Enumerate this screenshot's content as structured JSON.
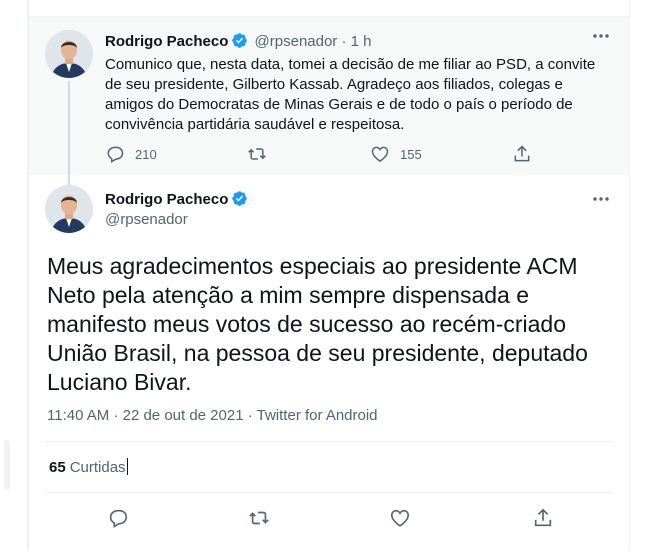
{
  "parent_tweet": {
    "author_name": "Rodrigo Pacheco",
    "handle": "@rpsenador",
    "separator": "·",
    "time": "1 h",
    "text": "Comunico que, nesta data, tomei a decisão de me filiar ao PSD, a convite de seu presidente, Gilberto Kassab. Agradeço aos filiados, colegas e amigos do Democratas de Minas Gerais e de todo o país o período de convivência partidária saudável e respeitosa.",
    "reply_count": "210",
    "retweet_count": "",
    "like_count": "155",
    "more_icon": "more-horizontal-icon"
  },
  "main_tweet": {
    "author_name": "Rodrigo Pacheco",
    "handle": "@rpsenador",
    "text": "Meus agradecimentos especiais ao presidente ACM Neto pela atenção a mim sempre dispensada e manifesto meus votos de sucesso ao recém-criado União Brasil, na pessoa de seu presidente, deputado Luciano Bivar.",
    "time": "11:40 AM",
    "date": "22 de out de 2021",
    "source": "Twitter for Android",
    "dot": "·",
    "likes_count": "65",
    "likes_label": "Curtidas"
  },
  "colors": {
    "verified": "#1d9bf0",
    "muted": "#536471",
    "text": "#0f1419",
    "parent_bg": "#f7f9f9"
  }
}
